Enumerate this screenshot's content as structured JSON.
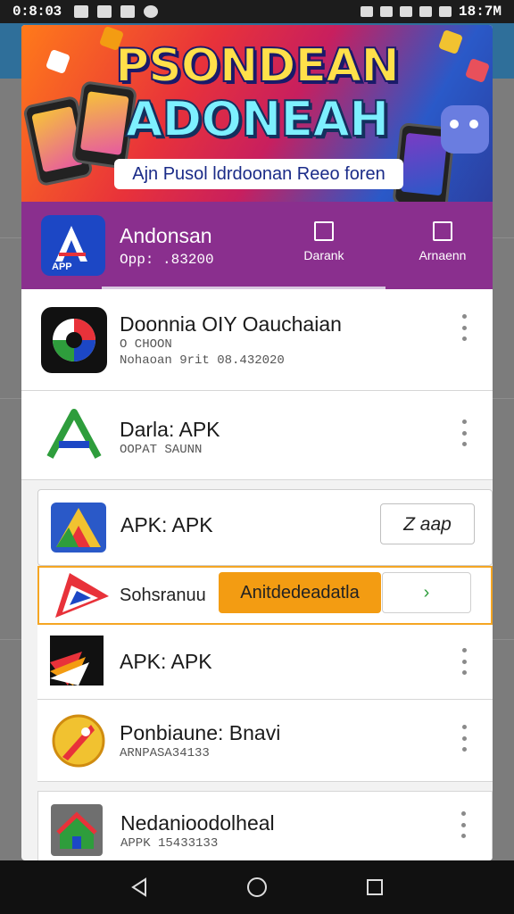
{
  "status_bar": {
    "time": "0:8:03",
    "clock": "18:7M"
  },
  "banner": {
    "title_line1": "PSONDEAN",
    "title_line2": "ADONEAH",
    "tagline": "Ajn Pusol ldrdoonan Reeo foren"
  },
  "app_header": {
    "logo_text": "APP",
    "name": "Andonsan",
    "subtitle": "Opp: .83200",
    "action1_label": "Darank",
    "action2_label": "Arnaenn"
  },
  "list": [
    {
      "title": "Doonnia OIY Oauchaian",
      "meta1": "O CHOON",
      "meta2": "Nohaoan 9rit 08.432020",
      "has_menu": true
    },
    {
      "title": "Darla: APK",
      "meta1": "OOPAT SAUNN",
      "meta2": "",
      "has_menu": true
    },
    {
      "title": "APK: APK",
      "meta1": "",
      "meta2": "",
      "has_menu": false,
      "button_label": "Z aap"
    },
    {
      "title": "APK: APK",
      "meta1": "",
      "meta2": "",
      "has_menu": true
    },
    {
      "title": "Ponbiaune: Bnavi",
      "meta1": "ARNPASA34133",
      "meta2": "",
      "has_menu": true
    },
    {
      "title": "Nedanioodolheal",
      "meta1": "APPK 15433133",
      "meta2": "",
      "has_menu": true
    }
  ],
  "popup": {
    "label": "Sohsranuu",
    "orange_button": "Anitdedeadatla",
    "next_button": "›"
  },
  "colors": {
    "header_purple": "#8a2f8e",
    "popup_orange": "#f39c12",
    "logo_blue": "#1c47c5"
  },
  "icons": [
    "back-icon",
    "home-icon",
    "recents-icon",
    "more-vert-icon",
    "chevron-right-icon",
    "wifi-icon",
    "battery-icon",
    "signal-icon"
  ]
}
